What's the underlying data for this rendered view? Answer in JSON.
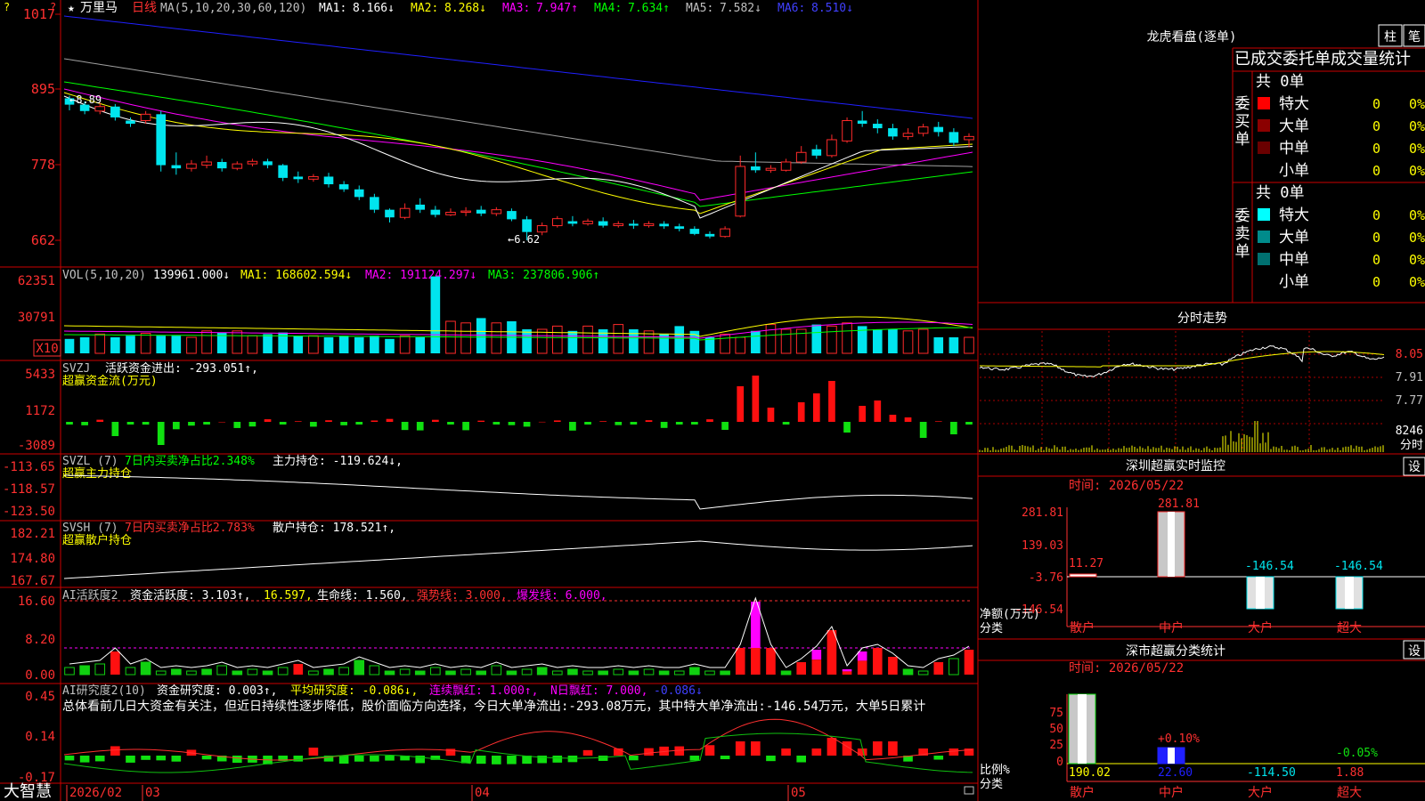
{
  "app": {
    "name": "大智慧"
  },
  "colors": {
    "up": "#ff2a2a",
    "down": "#00e5ee",
    "frame": "#cc0000",
    "ma1": "#ffffff",
    "ma2": "#ffff00",
    "ma3": "#ff00ff",
    "ma4": "#00ff00",
    "ma5": "#c0c0c0",
    "ma6": "#2020ff"
  },
  "main": {
    "stock": "万里马",
    "period": "日线",
    "ma_params": "MA(5,10,20,30,60,120)",
    "ma_values": [
      {
        "label": "MA1:",
        "value": "8.166↓",
        "color": "#ffffff"
      },
      {
        "label": "MA2:",
        "value": "8.268↓",
        "color": "#ffff00"
      },
      {
        "label": "MA3:",
        "value": "7.947↑",
        "color": "#ff00ff"
      },
      {
        "label": "MA4:",
        "value": "7.634↑",
        "color": "#00ff00"
      },
      {
        "label": "MA5:",
        "value": "7.582↓",
        "color": "#c0c0c0"
      },
      {
        "label": "MA6:",
        "value": "8.510↓",
        "color": "#2020ff"
      }
    ],
    "y_ticks": [
      "1017",
      "895",
      "778",
      "662"
    ],
    "high_marker": "8.89",
    "low_marker": "6.62"
  },
  "vol": {
    "params": "VOL(5,10,20)",
    "current": "139961.000↓",
    "ma1": "MA1: 168602.594↓",
    "ma2": "MA2: 191124.297↓",
    "ma3": "MA3: 237806.906↑",
    "y_ticks": [
      "62351",
      "30791"
    ],
    "unit": "X10",
    "values": [
      18,
      22,
      20,
      26,
      24,
      40,
      20,
      22,
      22,
      18,
      25,
      22,
      22,
      22,
      22,
      26,
      20,
      22,
      28,
      22,
      26,
      24,
      28,
      20,
      22,
      20,
      24,
      24,
      26,
      22,
      22,
      20,
      22,
      22,
      20,
      18,
      22,
      18,
      20,
      22,
      22,
      24,
      18,
      20,
      22,
      24,
      20,
      98,
      96,
      55,
      40,
      38,
      38,
      46,
      44,
      34,
      38,
      40,
      40,
      36,
      30,
      36,
      30,
      32,
      34,
      28,
      28,
      30,
      34,
      30,
      30,
      30,
      36,
      30,
      30,
      28,
      28,
      26,
      24,
      28,
      34,
      30,
      28,
      24,
      20,
      22,
      24,
      20,
      20,
      26,
      28,
      30,
      36,
      28,
      30,
      34,
      30,
      30,
      36,
      36,
      34,
      34,
      38,
      36,
      34,
      32,
      30,
      34,
      30,
      28,
      28,
      30,
      30
    ]
  },
  "svzj": {
    "name": "SVZJ",
    "label": "活跃资金进出: -293.051↑,",
    "title": "超赢资金流(万元)",
    "y_ticks": [
      "5433",
      "1172",
      "-3089"
    ]
  },
  "svzl": {
    "name": "SVZL (7)",
    "ratio": "7日内买卖净占比2.348%",
    "holding": "主力持仓: -119.624↓,",
    "title": "超赢主力持仓",
    "y_ticks": [
      "-113.65",
      "-118.57",
      "-123.50"
    ]
  },
  "svsh": {
    "name": "SVSH (7)",
    "ratio": "7日内买卖净占比2.783%",
    "holding": "散户持仓: 178.521↑,",
    "title": "超赢散户持仓",
    "y_ticks": [
      "182.21",
      "174.80",
      "167.67"
    ]
  },
  "ai_active": {
    "name": "AI活跃度2",
    "active": "资金活跃度: 3.103↑,",
    "v2": "16.597,",
    "life": "生命线: 1.560,",
    "strong": "强势线: 3.000,",
    "burst": "爆发线: 6.000,",
    "y_ticks": [
      "16.60",
      "8.20",
      "0.00"
    ]
  },
  "ai_research": {
    "name": "AI研究度2(10)",
    "research": "资金研究度: 0.003↑,",
    "avg": "平均研究度: -0.086↓,",
    "lianxu": "连续飘红: 1.000↑,",
    "nday": "N日飘红: 7.000,",
    "last": "-0.086↓",
    "comment": "总体看前几日大资金有关注，但近日持续性逐步降低，股价面临方向选择，今日大单净流出:-293.08万元，其中特大单净流出:-146.54万元，大单5日累计",
    "y_ticks": [
      "0.45",
      "0.14",
      "-0.17"
    ]
  },
  "x_axis": {
    "labels": [
      "2026/02",
      "03",
      "04",
      "05"
    ]
  },
  "dragon": {
    "title": "龙虎看盘(逐单)",
    "btn1": "柱",
    "btn2": "笔",
    "header": "已成交委托单成交量统计",
    "buy_label": "委买单",
    "sell_label": "委卖单",
    "buy_total": "共 0单",
    "sell_total": "共 0单",
    "buy_rows": [
      {
        "name": "特大",
        "count": "0",
        "pct": "0%",
        "color": "#ff0000"
      },
      {
        "name": "大单",
        "count": "0",
        "pct": "0%",
        "color": "#8b0000"
      },
      {
        "name": "中单",
        "count": "0",
        "pct": "0%",
        "color": "#6a0000"
      },
      {
        "name": "小单",
        "count": "0",
        "pct": "0%",
        "color": ""
      }
    ],
    "sell_rows": [
      {
        "name": "特大",
        "count": "0",
        "pct": "0%",
        "color": "#00ffff"
      },
      {
        "name": "大单",
        "count": "0",
        "pct": "0%",
        "color": "#008b8b"
      },
      {
        "name": "中单",
        "count": "0",
        "pct": "0%",
        "color": "#007070"
      },
      {
        "name": "小单",
        "count": "0",
        "pct": "0%",
        "color": ""
      }
    ]
  },
  "intraday": {
    "title": "分时走势",
    "y_ticks": [
      "8.05",
      "7.91",
      "7.77"
    ],
    "vol_label": "8246",
    "vol_unit": "分时"
  },
  "monitor": {
    "title": "深圳超赢实时监控",
    "settings": "设",
    "time": "时间: 2026/05/22",
    "y_ticks": [
      "281.81",
      "139.03",
      "-3.76",
      "-146.54"
    ],
    "ylabel": "净额(万元)",
    "xlabel": "分类",
    "categories": [
      "散户",
      "中户",
      "大户",
      "超大"
    ],
    "bar_labels": [
      "11.27",
      "281.81",
      "-146.54",
      "-146.54"
    ]
  },
  "classify": {
    "title": "深市超赢分类统计",
    "settings": "设",
    "time": "时间: 2026/05/22",
    "y_ticks": [
      "75",
      "50",
      "25",
      "0"
    ],
    "ylabel": "比例%",
    "xlabel": "分类",
    "categories": [
      "散户",
      "中户",
      "大户",
      "超大"
    ],
    "pct_labels": [
      "",
      "+0.10%",
      "",
      "-0.05%"
    ],
    "bottom_labels": [
      "190.02",
      "22.60",
      "-114.50",
      "1.88"
    ]
  },
  "chart_data": {
    "type": "candlestick",
    "ylim": [
      6.62,
      10.17
    ],
    "candles": [
      [
        8.85,
        8.75,
        8.89,
        8.66
      ],
      [
        8.75,
        8.65,
        8.8,
        8.6
      ],
      [
        8.65,
        8.72,
        8.78,
        8.6
      ],
      [
        8.72,
        8.55,
        8.76,
        8.5
      ],
      [
        8.5,
        8.45,
        8.55,
        8.4
      ],
      [
        8.5,
        8.6,
        8.65,
        8.45
      ],
      [
        8.6,
        7.8,
        8.65,
        7.7
      ],
      [
        7.8,
        7.75,
        8.0,
        7.65
      ],
      [
        7.75,
        7.82,
        7.88,
        7.7
      ],
      [
        7.8,
        7.85,
        7.95,
        7.75
      ],
      [
        7.85,
        7.75,
        7.9,
        7.7
      ],
      [
        7.75,
        7.82,
        7.86,
        7.72
      ],
      [
        7.82,
        7.86,
        7.9,
        7.78
      ],
      [
        7.86,
        7.8,
        7.9,
        7.75
      ],
      [
        7.8,
        7.6,
        7.82,
        7.55
      ],
      [
        7.62,
        7.58,
        7.7,
        7.52
      ],
      [
        7.58,
        7.62,
        7.66,
        7.54
      ],
      [
        7.62,
        7.5,
        7.68,
        7.45
      ],
      [
        7.5,
        7.42,
        7.55,
        7.38
      ],
      [
        7.42,
        7.3,
        7.48,
        7.25
      ],
      [
        7.3,
        7.1,
        7.35,
        7.05
      ],
      [
        7.1,
        6.98,
        7.12,
        6.9
      ],
      [
        6.98,
        7.12,
        7.2,
        6.95
      ],
      [
        7.18,
        7.1,
        7.28,
        7.05
      ],
      [
        7.1,
        7.02,
        7.16,
        6.98
      ],
      [
        7.02,
        7.06,
        7.12,
        7.0
      ],
      [
        7.06,
        7.08,
        7.14,
        7.0
      ],
      [
        7.1,
        7.04,
        7.16,
        7.0
      ],
      [
        7.04,
        7.1,
        7.14,
        7.0
      ],
      [
        7.08,
        6.95,
        7.12,
        6.92
      ],
      [
        6.95,
        6.75,
        7.0,
        6.62
      ],
      [
        6.75,
        6.85,
        6.9,
        6.7
      ],
      [
        6.85,
        6.96,
        7.0,
        6.82
      ],
      [
        6.92,
        6.88,
        7.0,
        6.84
      ],
      [
        6.88,
        6.92,
        6.96,
        6.85
      ],
      [
        6.92,
        6.85,
        6.98,
        6.82
      ],
      [
        6.85,
        6.88,
        6.92,
        6.82
      ],
      [
        6.88,
        6.85,
        6.94,
        6.8
      ],
      [
        6.85,
        6.88,
        6.92,
        6.82
      ],
      [
        6.88,
        6.84,
        6.92,
        6.8
      ],
      [
        6.84,
        6.8,
        6.88,
        6.76
      ],
      [
        6.8,
        6.72,
        6.84,
        6.7
      ],
      [
        6.72,
        6.68,
        6.76,
        6.65
      ],
      [
        6.68,
        6.8,
        6.84,
        6.66
      ],
      [
        7.0,
        7.78,
        7.95,
        6.98
      ],
      [
        7.78,
        7.72,
        8.0,
        7.68
      ],
      [
        7.72,
        7.75,
        7.8,
        7.68
      ],
      [
        7.72,
        7.85,
        7.9,
        7.7
      ],
      [
        7.85,
        8.0,
        8.1,
        7.82
      ],
      [
        8.05,
        7.95,
        8.12,
        7.9
      ],
      [
        7.95,
        8.2,
        8.28,
        7.92
      ],
      [
        8.18,
        8.5,
        8.55,
        8.15
      ],
      [
        8.5,
        8.45,
        8.65,
        8.4
      ],
      [
        8.45,
        8.38,
        8.52,
        8.3
      ],
      [
        8.38,
        8.25,
        8.45,
        8.2
      ],
      [
        8.25,
        8.3,
        8.38,
        8.2
      ],
      [
        8.3,
        8.4,
        8.45,
        8.25
      ],
      [
        8.4,
        8.32,
        8.48,
        8.25
      ],
      [
        8.32,
        8.15,
        8.38,
        8.1
      ],
      [
        8.2,
        8.25,
        8.3,
        8.08
      ]
    ]
  }
}
